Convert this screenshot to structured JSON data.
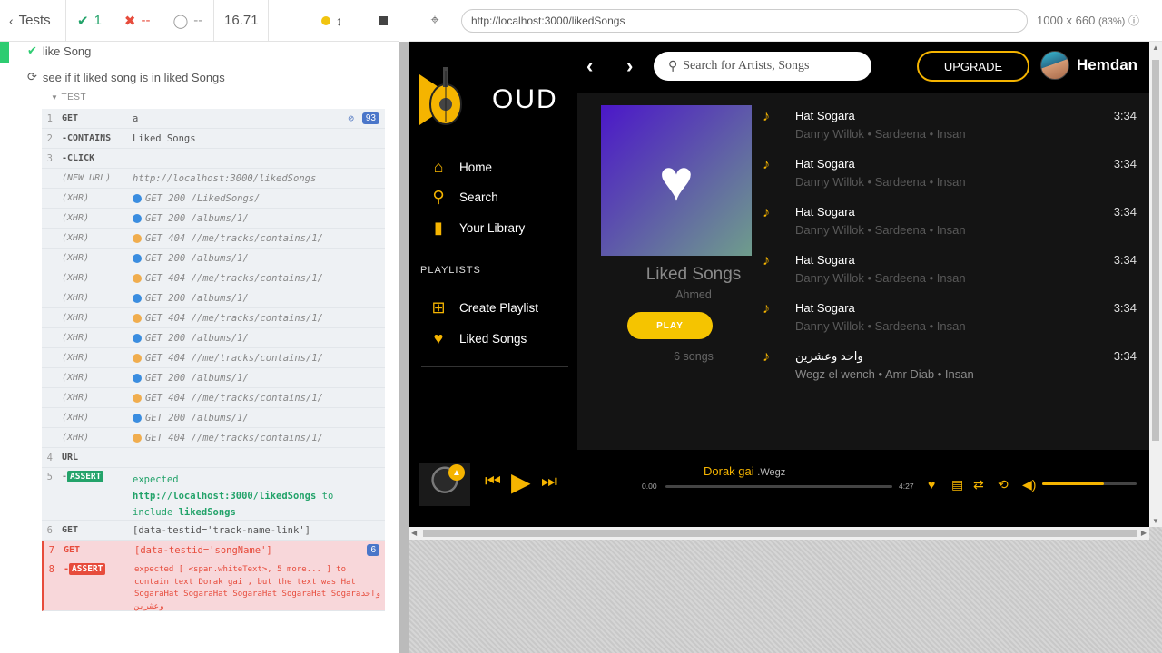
{
  "reporter": {
    "tests_label": "Tests",
    "passed": "1",
    "failed": "--",
    "pending": "--",
    "duration": "16.71",
    "test1": "like Song",
    "test2": "see if it liked song is in liked Songs",
    "section_label": "TEST",
    "commands": [
      {
        "num": "1",
        "name": "GET",
        "msg": "a",
        "badge": "93"
      },
      {
        "num": "2",
        "name": "-CONTAINS",
        "msg": "Liked Songs"
      },
      {
        "num": "3",
        "name": "-CLICK",
        "msg": ""
      },
      {
        "num": "",
        "name": "(NEW URL)",
        "msg": "http://localhost:3000/likedSongs"
      },
      {
        "num": "",
        "name": "(XHR)",
        "msg": "GET 200 /LikedSongs/",
        "status": "blue"
      },
      {
        "num": "",
        "name": "(XHR)",
        "msg": "GET 200 /albums/1/",
        "status": "blue"
      },
      {
        "num": "",
        "name": "(XHR)",
        "msg": "GET 404 //me/tracks/contains/1/",
        "status": "orange"
      },
      {
        "num": "",
        "name": "(XHR)",
        "msg": "GET 200 /albums/1/",
        "status": "blue"
      },
      {
        "num": "",
        "name": "(XHR)",
        "msg": "GET 404 //me/tracks/contains/1/",
        "status": "orange"
      },
      {
        "num": "",
        "name": "(XHR)",
        "msg": "GET 200 /albums/1/",
        "status": "blue"
      },
      {
        "num": "",
        "name": "(XHR)",
        "msg": "GET 404 //me/tracks/contains/1/",
        "status": "orange"
      },
      {
        "num": "",
        "name": "(XHR)",
        "msg": "GET 200 /albums/1/",
        "status": "blue"
      },
      {
        "num": "",
        "name": "(XHR)",
        "msg": "GET 404 //me/tracks/contains/1/",
        "status": "orange"
      },
      {
        "num": "",
        "name": "(XHR)",
        "msg": "GET 200 /albums/1/",
        "status": "blue"
      },
      {
        "num": "",
        "name": "(XHR)",
        "msg": "GET 404 //me/tracks/contains/1/",
        "status": "orange"
      },
      {
        "num": "",
        "name": "(XHR)",
        "msg": "GET 200 /albums/1/",
        "status": "blue"
      },
      {
        "num": "",
        "name": "(XHR)",
        "msg": "GET 404 //me/tracks/contains/1/",
        "status": "orange"
      },
      {
        "num": "4",
        "name": "URL",
        "msg": ""
      }
    ],
    "assert1": {
      "num": "5",
      "tag": "ASSERT",
      "p1": "expected",
      "p2": "http://localhost:3000/likedSongs",
      "p3": "to",
      "p4": "include",
      "p5": "likedSongs"
    },
    "cmd6": {
      "num": "6",
      "name": "GET",
      "msg": "[data-testid='track-name-link']"
    },
    "cmd7": {
      "num": "7",
      "name": "GET",
      "msg": "[data-testid='songName']",
      "badge": "6"
    },
    "assert2": {
      "num": "8",
      "tag": "ASSERT",
      "text": "expected [ <span.whiteText>, 5 more... ] to contain text Dorak gai , but the text was Hat SogaraHat SogaraHat SogaraHat SogaraHat Sogaraواحد وعشرين"
    }
  },
  "preview": {
    "url": "http://localhost:3000/likedSongs",
    "size": "1000 x 660",
    "zoom": "(83%)"
  },
  "app": {
    "logo_text": "OUD",
    "nav": {
      "home": "Home",
      "search": "Search",
      "library": "Your Library"
    },
    "playlists_heading": "PLAYLISTS",
    "create_playlist": "Create Playlist",
    "liked_songs": "Liked Songs",
    "search_placeholder": "Search for Artists, Songs",
    "upgrade": "UPGRADE",
    "username": "Hemdan",
    "playlist": {
      "title": "Liked Songs",
      "owner": "Ahmed",
      "play": "PLAY",
      "count": "6 songs"
    },
    "tracks": [
      {
        "name": "Hat Sogara",
        "artists": "Danny Willok • Sardeena • Insan",
        "duration": "3:34"
      },
      {
        "name": "Hat Sogara",
        "artists": "Danny Willok • Sardeena • Insan",
        "duration": "3:34"
      },
      {
        "name": "Hat Sogara",
        "artists": "Danny Willok • Sardeena • Insan",
        "duration": "3:34"
      },
      {
        "name": "Hat Sogara",
        "artists": "Danny Willok • Sardeena • Insan",
        "duration": "3:34"
      },
      {
        "name": "Hat Sogara",
        "artists": "Danny Willok • Sardeena • Insan",
        "duration": "3:34"
      },
      {
        "name": "واحد وعشرين",
        "artists": "Wegz el wench • Amr Diab • Insan",
        "duration": "3:34"
      }
    ],
    "player": {
      "title": "Dorak gai",
      "artist": ".Wegz",
      "elapsed": "0.00",
      "total": "4:27",
      "progress": 0,
      "volume": 0.65
    }
  },
  "colors": {
    "accent": "#f5b400",
    "pass": "#2ecc71",
    "fail": "#e74c3c"
  }
}
